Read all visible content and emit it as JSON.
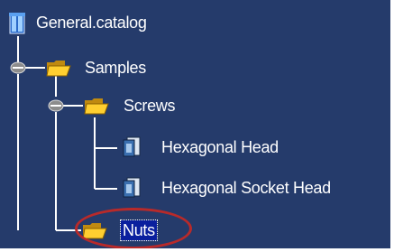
{
  "tree": {
    "root": {
      "label": "General.catalog",
      "icon": "catalog-book-icon"
    },
    "samples": {
      "label": "Samples",
      "icon": "open-folder-icon",
      "expanded": true
    },
    "screws": {
      "label": "Screws",
      "icon": "open-folder-icon",
      "expanded": true
    },
    "hex_head": {
      "label": "Hexagonal Head",
      "icon": "part-document-icon"
    },
    "hex_socket": {
      "label": "Hexagonal Socket Head",
      "icon": "part-document-icon"
    },
    "nuts": {
      "label": "Nuts",
      "icon": "open-folder-icon",
      "selected": true
    }
  },
  "colors": {
    "background": "#253b6b",
    "text": "#ffffff",
    "selection": "#0a1f9e",
    "annotation_ring": "#b82a2a"
  }
}
